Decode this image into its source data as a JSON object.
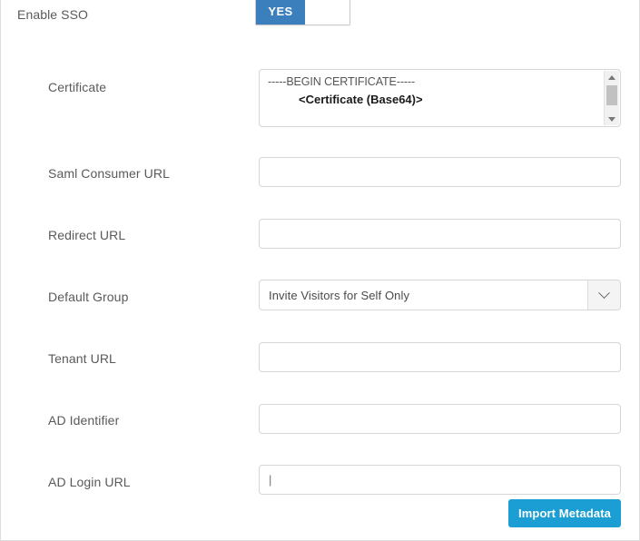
{
  "form": {
    "sso": {
      "label": "Enable SSO",
      "toggle_on_label": "YES",
      "toggle_state": "YES"
    },
    "fields": [
      {
        "name": "certificate",
        "label": "Certificate",
        "type": "textarea",
        "line1": "-----BEGIN CERTIFICATE-----",
        "line2": "<Certificate (Base64)>",
        "placeholder": ""
      },
      {
        "name": "saml-consumer-url",
        "label": "Saml Consumer URL",
        "type": "text",
        "value": "",
        "placeholder": ""
      },
      {
        "name": "redirect-url",
        "label": "Redirect URL",
        "type": "text",
        "value": "",
        "placeholder": ""
      },
      {
        "name": "default-group",
        "label": "Default Group",
        "type": "select",
        "value": "Invite Visitors for Self Only",
        "icon": "chevron-down-icon"
      },
      {
        "name": "tenant-url",
        "label": "Tenant URL",
        "type": "text",
        "value": "",
        "placeholder": ""
      },
      {
        "name": "ad-identifier",
        "label": "AD Identifier",
        "type": "text",
        "value": "",
        "placeholder": ""
      },
      {
        "name": "ad-login-url",
        "label": "AD Login URL",
        "type": "text",
        "value": "",
        "placeholder": "|",
        "focused": true
      }
    ],
    "actions": {
      "import_metadata_label": "Import Metadata"
    }
  },
  "colors": {
    "toggle_on": "#3b7fbc",
    "primary_button": "#1a9ed4",
    "label_text": "#5a5a5a",
    "border": "#d6d6d6",
    "caret": "#e8b463"
  }
}
